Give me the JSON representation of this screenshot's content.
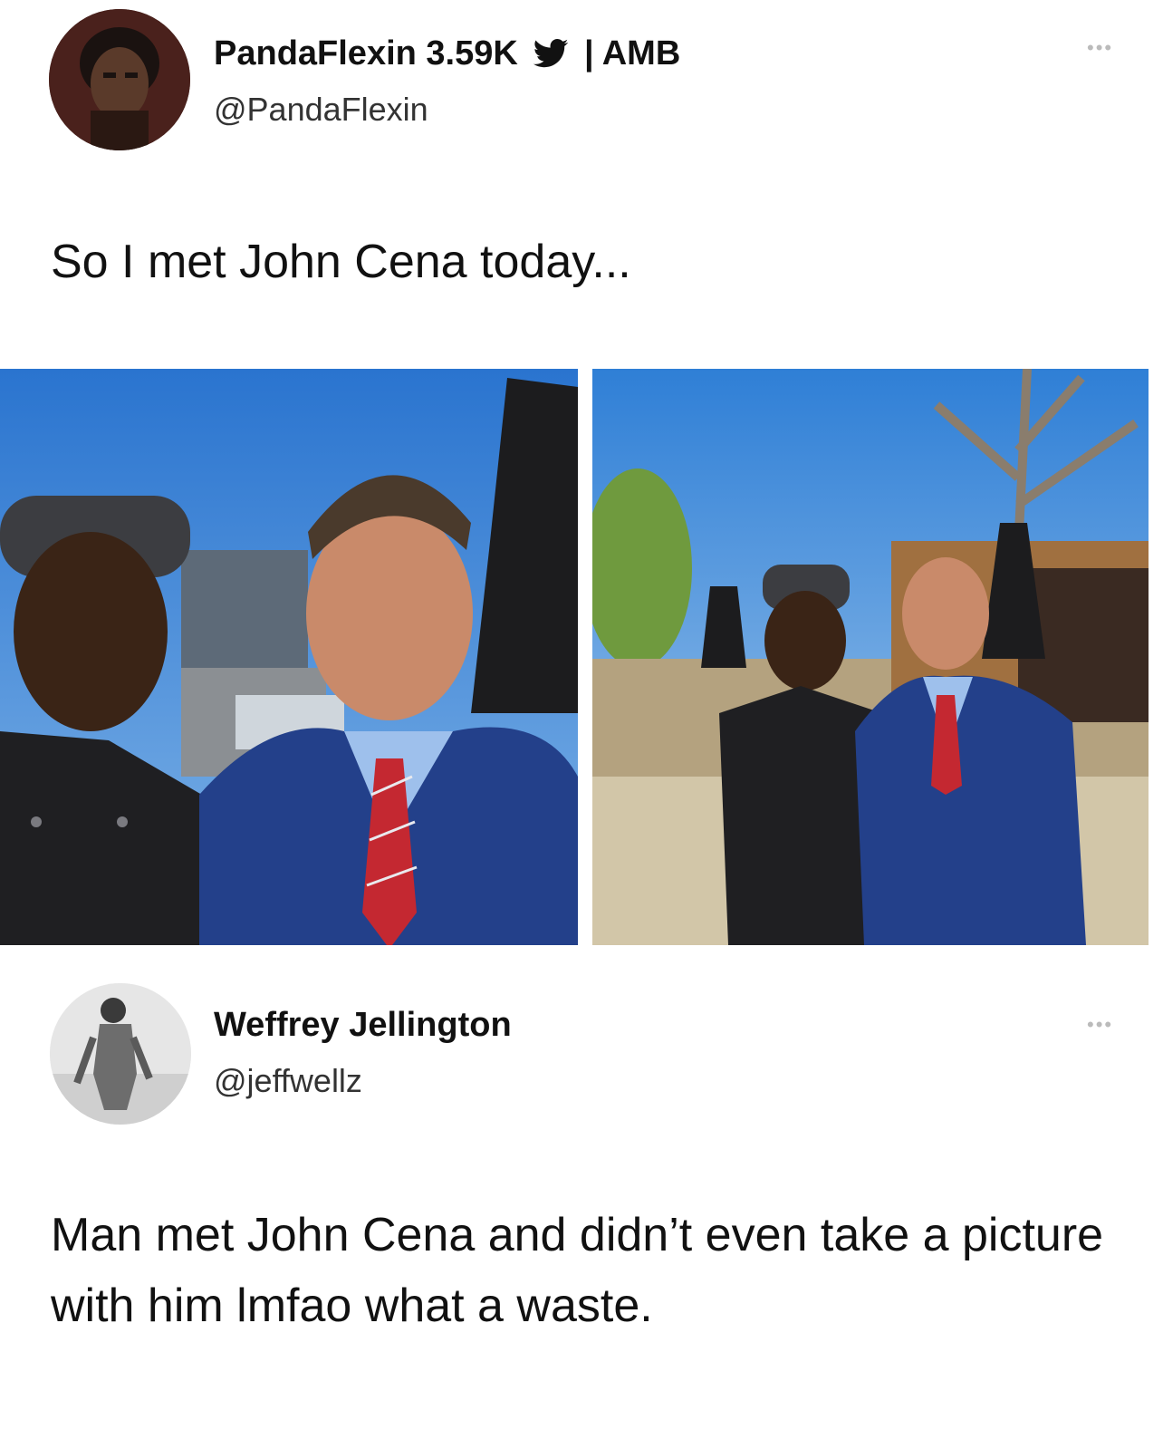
{
  "tweet": {
    "display_name": "PandaFlexin 3.59K",
    "name_suffix": "| AMB",
    "handle": "@PandaFlexin",
    "text": "So I met John Cena today...",
    "more_label": "•••"
  },
  "reply": {
    "display_name": "Weffrey Jellington",
    "handle": "@jeffwellz",
    "text": "Man met John Cena and didn’t even take a picture with him lmfao what a waste.",
    "more_label": "•••"
  },
  "icons": {
    "verified_platform": "twitter-bird-icon",
    "more": "more-options-icon"
  },
  "colors": {
    "sky": "#2f7fd6",
    "suit": "#23408a",
    "tie": "#c42831",
    "chef_uniform": "#1f1f22"
  }
}
